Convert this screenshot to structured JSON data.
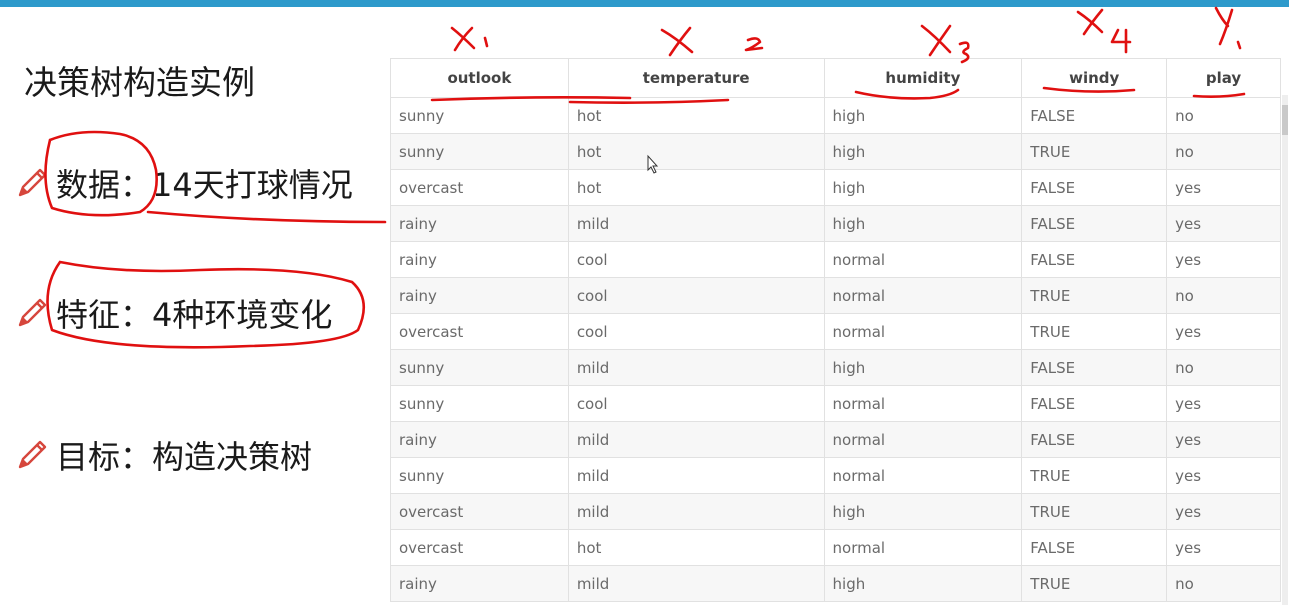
{
  "slide": {
    "title": "决策树构造实例",
    "bullets": [
      {
        "text": "数据：14天打球情况"
      },
      {
        "text": "特征：4种环境变化"
      },
      {
        "text": "目标：构造决策树"
      }
    ]
  },
  "table": {
    "headers": [
      "outlook",
      "temperature",
      "humidity",
      "windy",
      "play"
    ],
    "rows": [
      [
        "sunny",
        "hot",
        "high",
        "FALSE",
        "no"
      ],
      [
        "sunny",
        "hot",
        "high",
        "TRUE",
        "no"
      ],
      [
        "overcast",
        "hot",
        "high",
        "FALSE",
        "yes"
      ],
      [
        "rainy",
        "mild",
        "high",
        "FALSE",
        "yes"
      ],
      [
        "rainy",
        "cool",
        "normal",
        "FALSE",
        "yes"
      ],
      [
        "rainy",
        "cool",
        "normal",
        "TRUE",
        "no"
      ],
      [
        "overcast",
        "cool",
        "normal",
        "TRUE",
        "yes"
      ],
      [
        "sunny",
        "mild",
        "high",
        "FALSE",
        "no"
      ],
      [
        "sunny",
        "cool",
        "normal",
        "FALSE",
        "yes"
      ],
      [
        "rainy",
        "mild",
        "normal",
        "FALSE",
        "yes"
      ],
      [
        "sunny",
        "mild",
        "normal",
        "TRUE",
        "yes"
      ],
      [
        "overcast",
        "mild",
        "high",
        "TRUE",
        "yes"
      ],
      [
        "overcast",
        "hot",
        "normal",
        "FALSE",
        "yes"
      ],
      [
        "rainy",
        "mild",
        "high",
        "TRUE",
        "no"
      ]
    ]
  },
  "annotations": {
    "handwritten_labels": [
      "X₁",
      "X₂",
      "X₃",
      "X₄",
      "Y"
    ],
    "ink_color": "#e01010"
  },
  "colors": {
    "accent_bar": "#2e9acb",
    "pencil": "#d6463c"
  }
}
